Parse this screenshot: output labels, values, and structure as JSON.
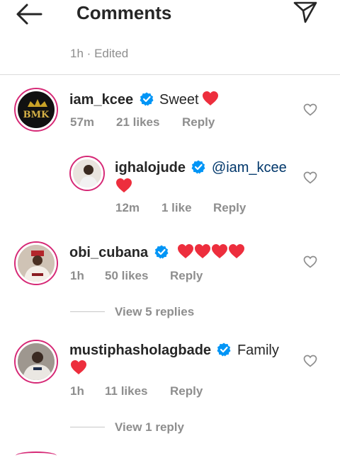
{
  "header": {
    "title": "Comments"
  },
  "post_meta": {
    "time": "1h",
    "separator": "·",
    "edited": "Edited"
  },
  "comments": [
    {
      "username": "iam_kcee",
      "text": "Sweet",
      "emoji": "heart",
      "time": "57m",
      "likes": "21 likes",
      "reply": "Reply",
      "replies": [
        {
          "username": "ighalojude",
          "mention": "@iam_kcee",
          "emoji": "heart",
          "time": "12m",
          "likes": "1 like",
          "reply": "Reply"
        }
      ]
    },
    {
      "username": "obi_cubana",
      "text": "",
      "emoji": "heart x4",
      "time": "1h",
      "likes": "50 likes",
      "reply": "Reply",
      "view_replies": "View 5 replies"
    },
    {
      "username": "mustiphasholagbade",
      "text": "Family",
      "emoji": "heart",
      "time": "1h",
      "likes": "11 likes",
      "reply": "Reply",
      "view_replies": "View 1 reply"
    }
  ],
  "avatar_badge": {
    "text": "BMK"
  },
  "colors": {
    "verified": "#0095f6",
    "heart": "#ed2e3d",
    "ring": "#d62976",
    "muted": "#8e8e8e"
  }
}
